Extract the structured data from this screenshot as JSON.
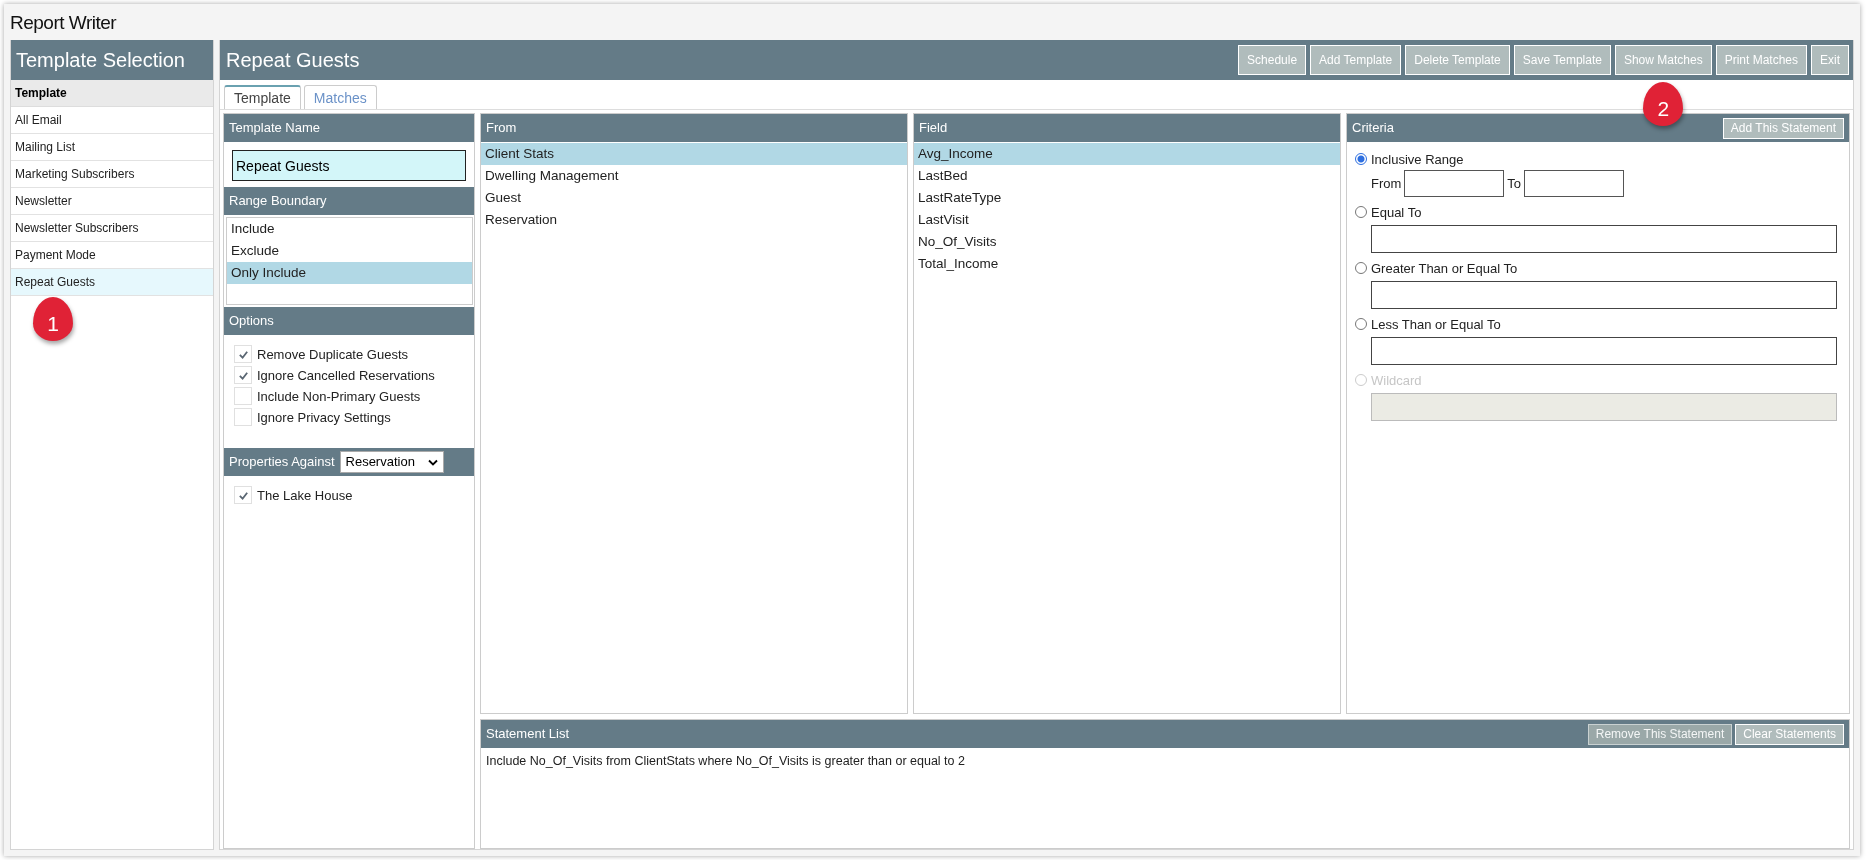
{
  "window": {
    "title": "Report Writer"
  },
  "sidebar": {
    "title": "Template Selection",
    "items": [
      {
        "label": "Template",
        "kind": "header"
      },
      {
        "label": "All Email",
        "kind": "item",
        "selected": false
      },
      {
        "label": "Mailing List",
        "kind": "item",
        "selected": false
      },
      {
        "label": "Marketing Subscribers",
        "kind": "item",
        "selected": false
      },
      {
        "label": "Newsletter",
        "kind": "item",
        "selected": false
      },
      {
        "label": "Newsletter Subscribers",
        "kind": "item",
        "selected": false
      },
      {
        "label": "Payment Mode",
        "kind": "item",
        "selected": false
      },
      {
        "label": "Repeat Guests",
        "kind": "item",
        "selected": true,
        "callout": "1"
      }
    ]
  },
  "main": {
    "title": "Repeat Guests",
    "toolbar": [
      {
        "label": "Schedule"
      },
      {
        "label": "Add Template"
      },
      {
        "label": "Delete Template"
      },
      {
        "label": "Save Template"
      },
      {
        "label": "Show Matches",
        "callout": "2"
      },
      {
        "label": "Print Matches"
      },
      {
        "label": "Exit"
      }
    ],
    "tabs": [
      {
        "label": "Template",
        "selected": true
      },
      {
        "label": "Matches",
        "selected": false
      }
    ]
  },
  "template_name": {
    "heading": "Template Name",
    "value": "Repeat Guests"
  },
  "range_boundary": {
    "heading": "Range Boundary",
    "options": [
      {
        "label": "Include",
        "selected": false
      },
      {
        "label": "Exclude",
        "selected": false
      },
      {
        "label": "Only Include",
        "selected": true
      }
    ]
  },
  "options": {
    "heading": "Options",
    "items": [
      {
        "label": "Remove Duplicate Guests",
        "checked": true
      },
      {
        "label": "Ignore Cancelled Reservations",
        "checked": true
      },
      {
        "label": "Include Non-Primary Guests",
        "checked": false
      },
      {
        "label": "Ignore Privacy Settings",
        "checked": false
      }
    ]
  },
  "properties": {
    "heading": "Properties Against",
    "select_value": "Reservation",
    "items": [
      {
        "label": "The Lake House",
        "checked": true
      }
    ]
  },
  "from": {
    "heading": "From",
    "items": [
      {
        "label": "Client Stats",
        "selected": true
      },
      {
        "label": "Dwelling Management",
        "selected": false
      },
      {
        "label": "Guest",
        "selected": false
      },
      {
        "label": "Reservation",
        "selected": false
      }
    ]
  },
  "field": {
    "heading": "Field",
    "items": [
      {
        "label": "Avg_Income",
        "selected": true
      },
      {
        "label": "LastBed",
        "selected": false
      },
      {
        "label": "LastRateType",
        "selected": false
      },
      {
        "label": "LastVisit",
        "selected": false
      },
      {
        "label": "No_Of_Visits",
        "selected": false
      },
      {
        "label": "Total_Income",
        "selected": false
      }
    ]
  },
  "criteria": {
    "heading": "Criteria",
    "button": "Add This Statement",
    "options": [
      {
        "kind": "range",
        "label": "Inclusive Range",
        "selected": true,
        "disabled": false,
        "from_label": "From",
        "to_label": "To"
      },
      {
        "kind": "single",
        "label": "Equal To",
        "selected": false,
        "disabled": false
      },
      {
        "kind": "single",
        "label": "Greater Than or Equal To",
        "selected": false,
        "disabled": false
      },
      {
        "kind": "single",
        "label": "Less Than or Equal To",
        "selected": false,
        "disabled": false
      },
      {
        "kind": "single",
        "label": "Wildcard",
        "selected": false,
        "disabled": true
      }
    ]
  },
  "statement_list": {
    "heading": "Statement List",
    "buttons": [
      {
        "label": "Remove This Statement",
        "disabled": true
      },
      {
        "label": "Clear Statements",
        "disabled": false
      }
    ],
    "statements": [
      "Include No_Of_Visits from ClientStats where No_Of_Visits is greater than or equal to 2"
    ]
  }
}
